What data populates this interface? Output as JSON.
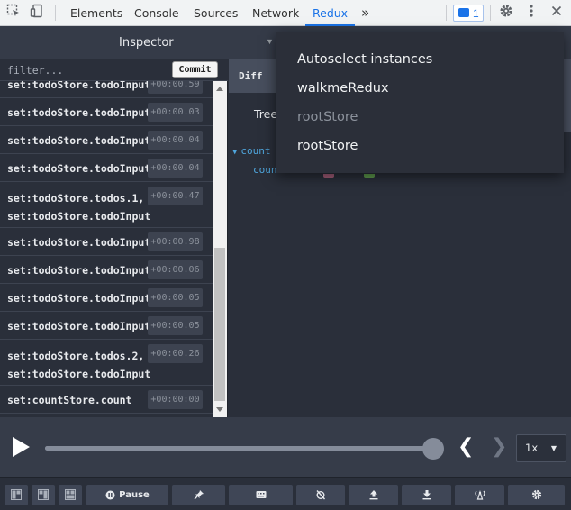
{
  "devtools": {
    "tabs": [
      {
        "label": "Elements"
      },
      {
        "label": "Console"
      },
      {
        "label": "Sources"
      },
      {
        "label": "Network"
      },
      {
        "label": "Redux"
      }
    ],
    "more_label": "»",
    "message_count": "1",
    "active_tab": "Redux"
  },
  "monitor": {
    "title": "Inspector",
    "filter_placeholder": "filter...",
    "commit_label": "Commit"
  },
  "actions": [
    {
      "lines": [
        "set:todoStore.todoInput"
      ],
      "time": "+00:00.59"
    },
    {
      "lines": [
        "set:todoStore.todoInput"
      ],
      "time": "+00:00.03"
    },
    {
      "lines": [
        "set:todoStore.todoInput"
      ],
      "time": "+00:00.04"
    },
    {
      "lines": [
        "set:todoStore.todoInput"
      ],
      "time": "+00:00.04"
    },
    {
      "lines": [
        "set:todoStore.todos.1,",
        "set:todoStore.todoInput"
      ],
      "time": "+00:00.47"
    },
    {
      "lines": [
        "set:todoStore.todoInput"
      ],
      "time": "+00:00.98"
    },
    {
      "lines": [
        "set:todoStore.todoInput"
      ],
      "time": "+00:00.06"
    },
    {
      "lines": [
        "set:todoStore.todoInput"
      ],
      "time": "+00:00.05"
    },
    {
      "lines": [
        "set:todoStore.todoInput"
      ],
      "time": "+00:00.05"
    },
    {
      "lines": [
        "set:todoStore.todos.2,",
        "set:todoStore.todoInput"
      ],
      "time": "+00:00.26"
    },
    {
      "lines": [
        "set:countStore.count"
      ],
      "time": "+00:00:00"
    }
  ],
  "detail": {
    "diff_tab": "Diff",
    "tree_tab": "Tree",
    "tree_key_1": "count",
    "tree_key_2": "coun"
  },
  "instance_menu": {
    "items": [
      {
        "label": "Autoselect instances",
        "disabled": false
      },
      {
        "label": "walkmeRedux",
        "disabled": false
      },
      {
        "label": "rootStore",
        "disabled": true
      },
      {
        "label": "rootStore",
        "disabled": false
      }
    ]
  },
  "slider": {
    "progress_percent": 100,
    "speed": "1x"
  },
  "toolbar": {
    "pause_label": "Pause"
  },
  "colors": {
    "accent": "#1a73e8",
    "panel_bg": "#2a2f3a",
    "tree_key": "#4fa6dd"
  }
}
